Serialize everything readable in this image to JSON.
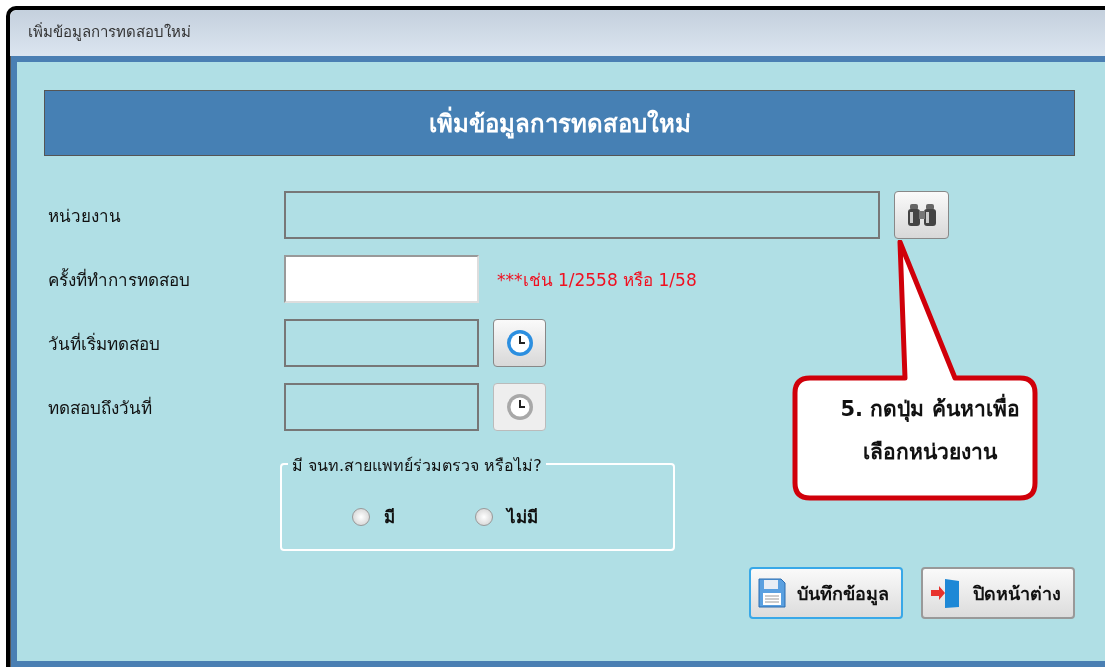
{
  "window": {
    "title": "เพิ่มข้อมูลการทดสอบใหม่"
  },
  "header": "เพิ่มข้อมูลการทดสอบใหม่",
  "fields": [
    {
      "kind": "lookup",
      "label": "หน่วยงาน",
      "editable": false
    },
    {
      "kind": "text",
      "label": "ครั้งที่ทำการทดสอบ",
      "editable": true,
      "hint": "***เช่น 1/2558 หรือ 1/58"
    },
    {
      "kind": "date",
      "label": "วันที่เริ่มทดสอบ",
      "editable": false,
      "picker_disabled": false
    },
    {
      "kind": "date",
      "label": "ทดสอบถึงวันที่",
      "editable": false,
      "picker_disabled": true
    }
  ],
  "group": {
    "title": "มี จนท.สายแพทย์ร่วมตรวจ หรือไม่?",
    "options": [
      {
        "label": "มี",
        "selected": false
      },
      {
        "label": "ไม่มี",
        "selected": false
      }
    ]
  },
  "buttons": [
    {
      "kind": "save",
      "label": "บันทึกข้อมูล",
      "focused": true
    },
    {
      "kind": "close",
      "label": "ปิดหน้าต่าง",
      "focused": false
    }
  ],
  "callout": {
    "lines": [
      "5. กดปุ่ม ค้นหาเพื่อ",
      "เลือกหน่วยงาน"
    ]
  }
}
